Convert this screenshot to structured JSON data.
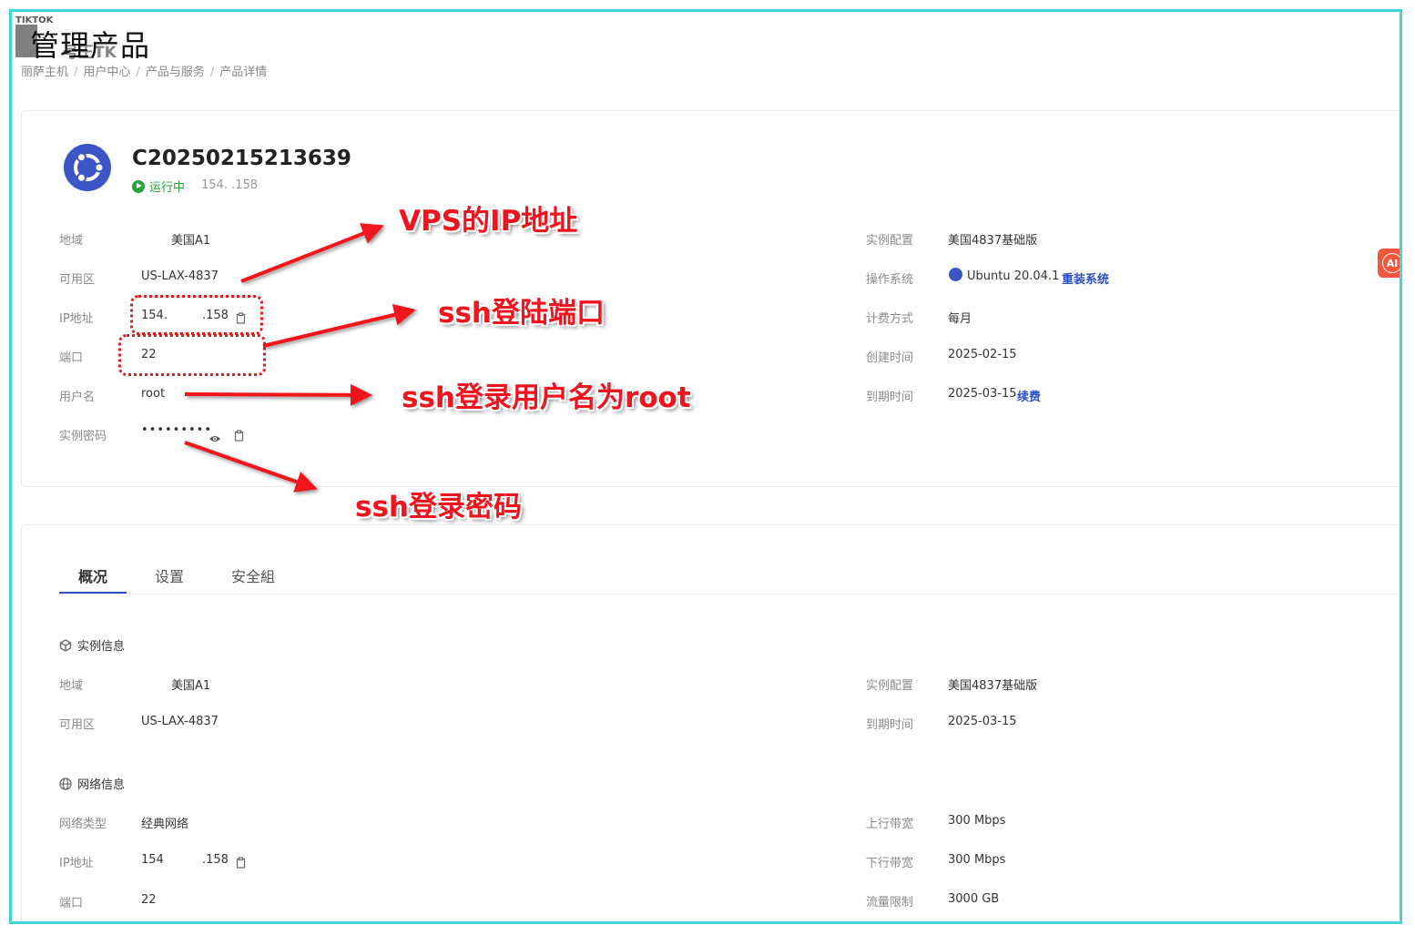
{
  "watermark": {
    "top": "TIKTOK",
    "sub": "号王TK"
  },
  "page_title": "管理产品",
  "breadcrumb": [
    "丽萨主机",
    "用户中心",
    "产品与服务",
    "产品详情"
  ],
  "server": {
    "name": "C20250215213639",
    "status": "运行中",
    "ip_masked": "154.        .158",
    "os_icon": "ubuntu-logo-icon"
  },
  "details": {
    "region_label": "地域",
    "region_value": "美国A1",
    "zone_label": "可用区",
    "zone_value": "US-LAX-4837",
    "ip_label": "IP地址",
    "ip_value": "154.",
    "ip_value_tail": ".158",
    "port_label": "端口",
    "port_value": "22",
    "user_label": "用户名",
    "user_value": "root",
    "password_label": "实例密码",
    "password_value": "•••••••••",
    "config_label": "实例配置",
    "config_value": "美国4837基础版",
    "os_label": "操作系统",
    "os_value": "Ubuntu 20.04.1",
    "reinstall_link": "重装系统",
    "billing_label": "计费方式",
    "billing_value": "每月",
    "created_label": "创建时间",
    "created_value": "2025-02-15",
    "expire_label": "到期时间",
    "expire_value": "2025-03-15",
    "renew_link": "续费"
  },
  "annotations": {
    "ip": "VPS的IP地址",
    "port": "ssh登陆端口",
    "user": "ssh登录用户名为root",
    "password": "ssh登录密码"
  },
  "tabs": [
    "概况",
    "设置",
    "安全組"
  ],
  "instance_info": {
    "title": "实例信息",
    "region_label": "地域",
    "region_value": "美国A1",
    "zone_label": "可用区",
    "zone_value": "US-LAX-4837",
    "config_label": "实例配置",
    "config_value": "美国4837基础版",
    "expire_label": "到期时间",
    "expire_value": "2025-03-15"
  },
  "network_info": {
    "title": "网络信息",
    "type_label": "网络类型",
    "type_value": "经典网络",
    "ip_label": "IP地址",
    "ip_value": "154",
    "ip_value_tail": ".158",
    "port_label": "端口",
    "port_value": "22",
    "up_label": "上行带宽",
    "up_value": "300 Mbps",
    "down_label": "下行带宽",
    "down_value": "300 Mbps",
    "traffic_label": "流量限制",
    "traffic_value": "3000 GB"
  },
  "ai_button": "AI",
  "colors": {
    "accent": "#2b50c7",
    "running": "#27a33d",
    "annotation": "#f0141e",
    "frame": "#3fd6e0"
  }
}
